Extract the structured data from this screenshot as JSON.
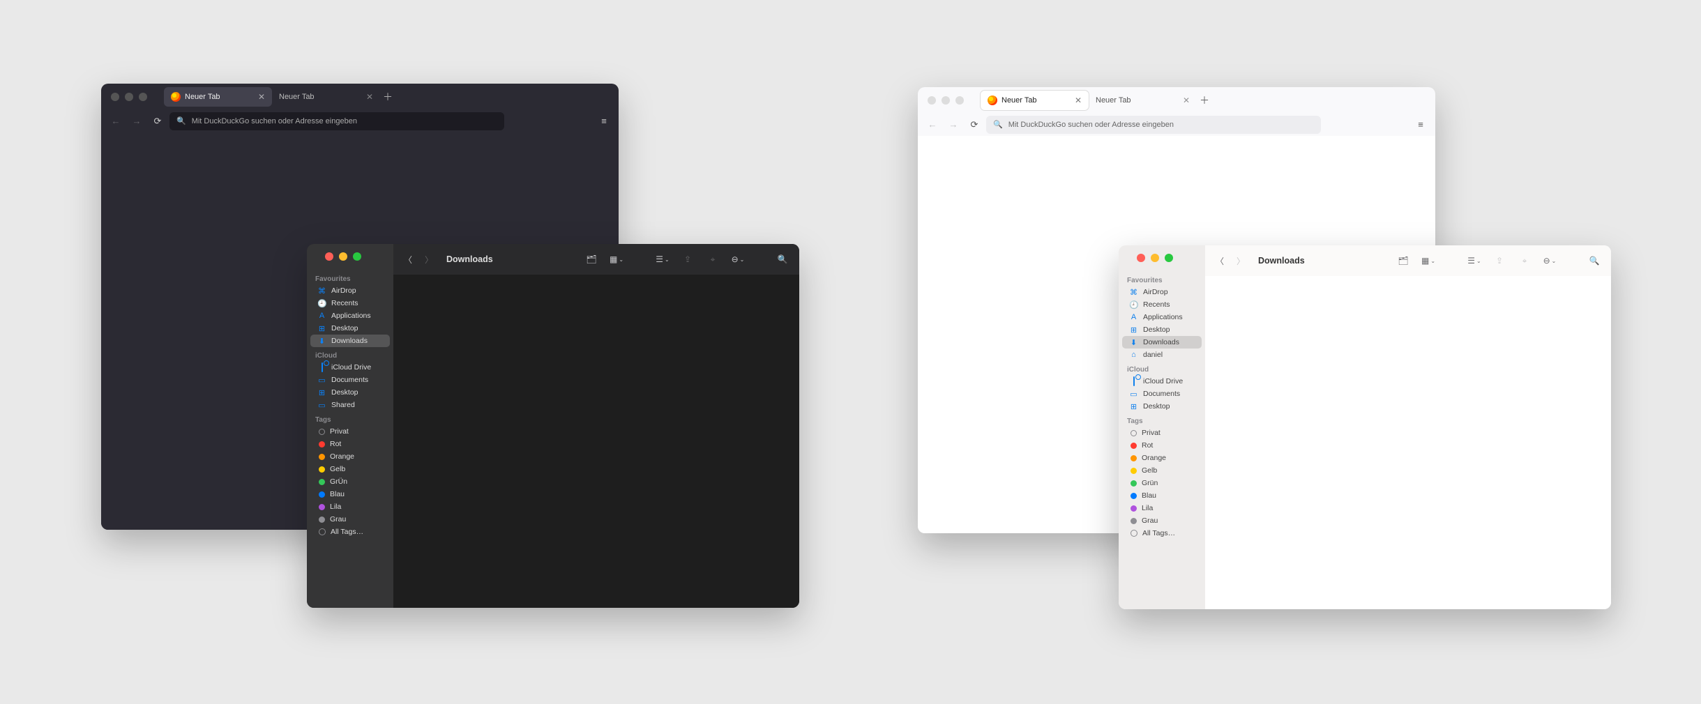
{
  "browser": {
    "tab_active_label": "Neuer Tab",
    "tab_inactive_label": "Neuer Tab",
    "url_placeholder": "Mit DuckDuckGo suchen oder Adresse eingeben"
  },
  "finder_dark": {
    "title": "Downloads",
    "favourites_header": "Favourites",
    "icloud_header": "iCloud",
    "tags_header": "Tags",
    "favourites": [
      {
        "icon": "⌘",
        "label": "AirDrop",
        "selected": false
      },
      {
        "icon": "🕘",
        "label": "Recents",
        "selected": false
      },
      {
        "icon": "A",
        "label": "Applications",
        "selected": false
      },
      {
        "icon": "⊞",
        "label": "Desktop",
        "selected": false
      },
      {
        "icon": "⬇",
        "label": "Downloads",
        "selected": true
      }
    ],
    "icloud": [
      {
        "icon": "cloud",
        "label": "iCloud Drive"
      },
      {
        "icon": "▭",
        "label": "Documents"
      },
      {
        "icon": "⊞",
        "label": "Desktop"
      },
      {
        "icon": "▭",
        "label": "Shared"
      }
    ],
    "tags": [
      {
        "color": "transparent",
        "label": "Privat",
        "outline": true
      },
      {
        "color": "#ff3b30",
        "label": "Rot"
      },
      {
        "color": "#ff9500",
        "label": "Orange"
      },
      {
        "color": "#ffcc00",
        "label": "Gelb"
      },
      {
        "color": "#34c759",
        "label": "GrÜn"
      },
      {
        "color": "#007aff",
        "label": "Blau"
      },
      {
        "color": "#af52de",
        "label": "Lila"
      },
      {
        "color": "#8e8e93",
        "label": "Grau"
      },
      {
        "color": "all",
        "label": "All Tags…"
      }
    ]
  },
  "finder_light": {
    "title": "Downloads",
    "favourites_header": "Favourites",
    "icloud_header": "iCloud",
    "tags_header": "Tags",
    "favourites": [
      {
        "icon": "⌘",
        "label": "AirDrop",
        "selected": false
      },
      {
        "icon": "🕘",
        "label": "Recents",
        "selected": false
      },
      {
        "icon": "A",
        "label": "Applications",
        "selected": false
      },
      {
        "icon": "⊞",
        "label": "Desktop",
        "selected": false
      },
      {
        "icon": "⬇",
        "label": "Downloads",
        "selected": true
      },
      {
        "icon": "⌂",
        "label": "daniel",
        "selected": false
      }
    ],
    "icloud": [
      {
        "icon": "cloud",
        "label": "iCloud Drive"
      },
      {
        "icon": "▭",
        "label": "Documents"
      },
      {
        "icon": "⊞",
        "label": "Desktop"
      }
    ],
    "tags": [
      {
        "color": "transparent",
        "label": "Privat",
        "outline": true
      },
      {
        "color": "#ff3b30",
        "label": "Rot"
      },
      {
        "color": "#ff9500",
        "label": "Orange"
      },
      {
        "color": "#ffcc00",
        "label": "Gelb"
      },
      {
        "color": "#34c759",
        "label": "Grün"
      },
      {
        "color": "#007aff",
        "label": "Blau"
      },
      {
        "color": "#af52de",
        "label": "Lila"
      },
      {
        "color": "#8e8e93",
        "label": "Grau"
      },
      {
        "color": "all",
        "label": "All Tags…"
      }
    ]
  }
}
